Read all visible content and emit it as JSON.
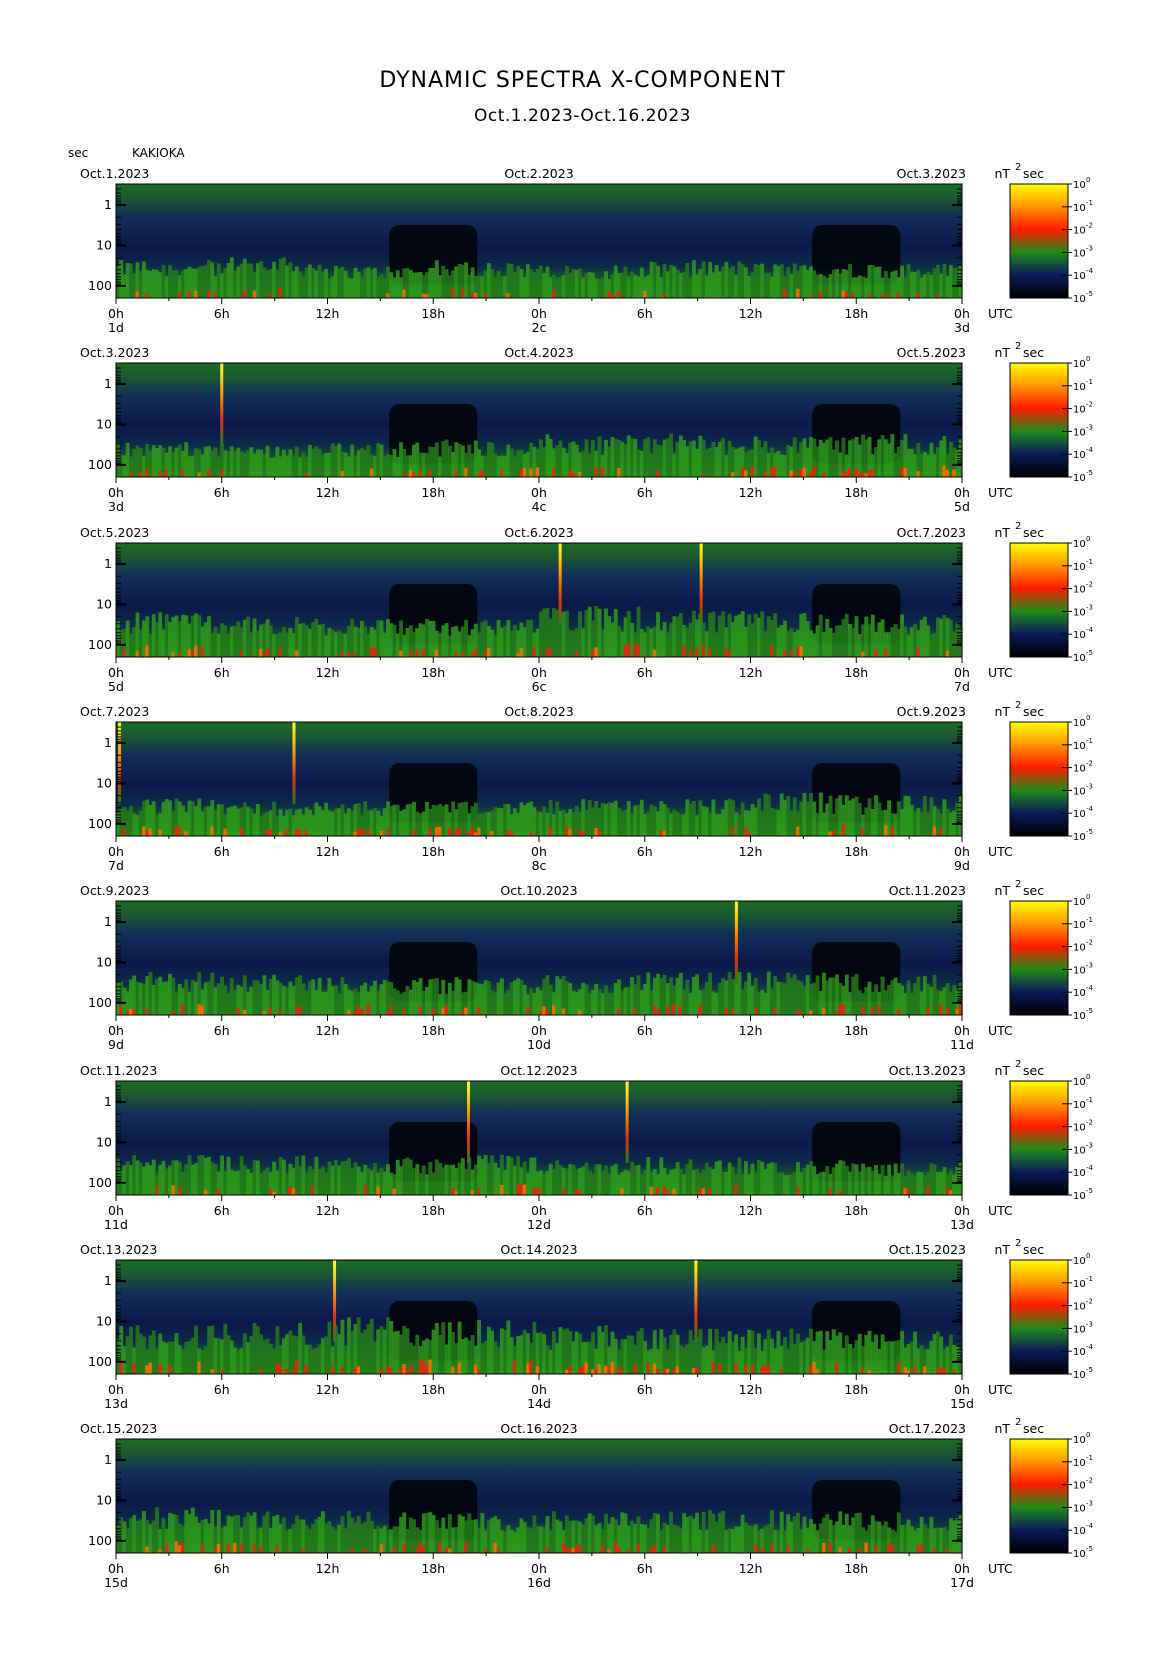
{
  "header": {
    "title": "DYNAMIC SPECTRA X-COMPONENT",
    "subtitle": "Oct.1.2023-Oct.16.2023",
    "y_unit": "sec",
    "station": "KAKIOKA"
  },
  "colorbar": {
    "unit_main": "nT",
    "unit_sup": "2",
    "unit_sec": "sec",
    "tick_base": "10",
    "exponents": [
      "0",
      "-1",
      "-2",
      "-3",
      "-4",
      "-5"
    ],
    "colors": [
      "#ffff00",
      "#ffa000",
      "#ff2000",
      "#1f8c1a",
      "#0a1a5a",
      "#000000"
    ]
  },
  "chart_data": {
    "type": "heatmap",
    "title": "DYNAMIC SPECTRA X-COMPONENT",
    "subtitle": "Oct.1.2023-Oct.16.2023",
    "ylabel": "sec",
    "y_scale": "log",
    "y_ticks": [
      "1",
      "10",
      "100"
    ],
    "x_tick_labels": [
      "0h",
      "6h",
      "12h",
      "18h",
      "0h",
      "6h",
      "12h",
      "18h",
      "0h"
    ],
    "x_unit": "UTC",
    "color_scale": "nT²sec, 10^-5 to 10^0 (log)",
    "panels": [
      {
        "left_date": "Oct.1.2023",
        "mid_date": "Oct.2.2023",
        "right_date": "Oct.3.2023",
        "day_start": "1d",
        "day_mid": "2c",
        "day_end": "3d",
        "spikes": [],
        "activity": [
          0.45,
          0.5,
          0.35,
          0.45,
          0.35,
          0.45,
          0.4,
          0.4
        ]
      },
      {
        "left_date": "Oct.3.2023",
        "mid_date": "Oct.4.2023",
        "right_date": "Oct.5.2023",
        "day_start": "3d",
        "day_mid": "4c",
        "day_end": "5d",
        "spikes": [
          6.0
        ],
        "activity": [
          0.4,
          0.35,
          0.4,
          0.45,
          0.55,
          0.55,
          0.5,
          0.55
        ]
      },
      {
        "left_date": "Oct.5.2023",
        "mid_date": "Oct.6.2023",
        "right_date": "Oct.7.2023",
        "day_start": "5d",
        "day_mid": "6c",
        "day_end": "7d",
        "spikes": [
          25.2,
          33.2
        ],
        "activity": [
          0.6,
          0.5,
          0.5,
          0.45,
          0.7,
          0.6,
          0.6,
          0.55
        ]
      },
      {
        "left_date": "Oct.7.2023",
        "mid_date": "Oct.8.2023",
        "right_date": "Oct.9.2023",
        "day_start": "7d",
        "day_mid": "8c",
        "day_end": "9d",
        "spikes": [
          0.2,
          10.1
        ],
        "activity": [
          0.45,
          0.4,
          0.4,
          0.4,
          0.45,
          0.45,
          0.55,
          0.5
        ]
      },
      {
        "left_date": "Oct.9.2023",
        "mid_date": "Oct.10.2023",
        "right_date": "Oct.11.2023",
        "day_start": "9d",
        "day_mid": "10d",
        "day_end": "11d",
        "spikes": [
          35.2
        ],
        "activity": [
          0.55,
          0.5,
          0.5,
          0.45,
          0.5,
          0.55,
          0.55,
          0.5
        ]
      },
      {
        "left_date": "Oct.11.2023",
        "mid_date": "Oct.12.2023",
        "right_date": "Oct.13.2023",
        "day_start": "11d",
        "day_mid": "12d",
        "day_end": "13d",
        "spikes": [
          20.0,
          29.0
        ],
        "activity": [
          0.5,
          0.5,
          0.45,
          0.5,
          0.4,
          0.45,
          0.4,
          0.35
        ]
      },
      {
        "left_date": "Oct.13.2023",
        "mid_date": "Oct.14.2023",
        "right_date": "Oct.15.2023",
        "day_start": "13d",
        "day_mid": "14d",
        "day_end": "15d",
        "spikes": [
          12.4,
          32.9
        ],
        "activity": [
          0.65,
          0.7,
          0.8,
          0.75,
          0.65,
          0.6,
          0.6,
          0.55
        ]
      },
      {
        "left_date": "Oct.15.2023",
        "mid_date": "Oct.16.2023",
        "right_date": "Oct.17.2023",
        "day_start": "15d",
        "day_mid": "16d",
        "day_end": "17d",
        "spikes": [],
        "activity": [
          0.6,
          0.55,
          0.55,
          0.5,
          0.55,
          0.55,
          0.55,
          0.5
        ]
      }
    ]
  }
}
